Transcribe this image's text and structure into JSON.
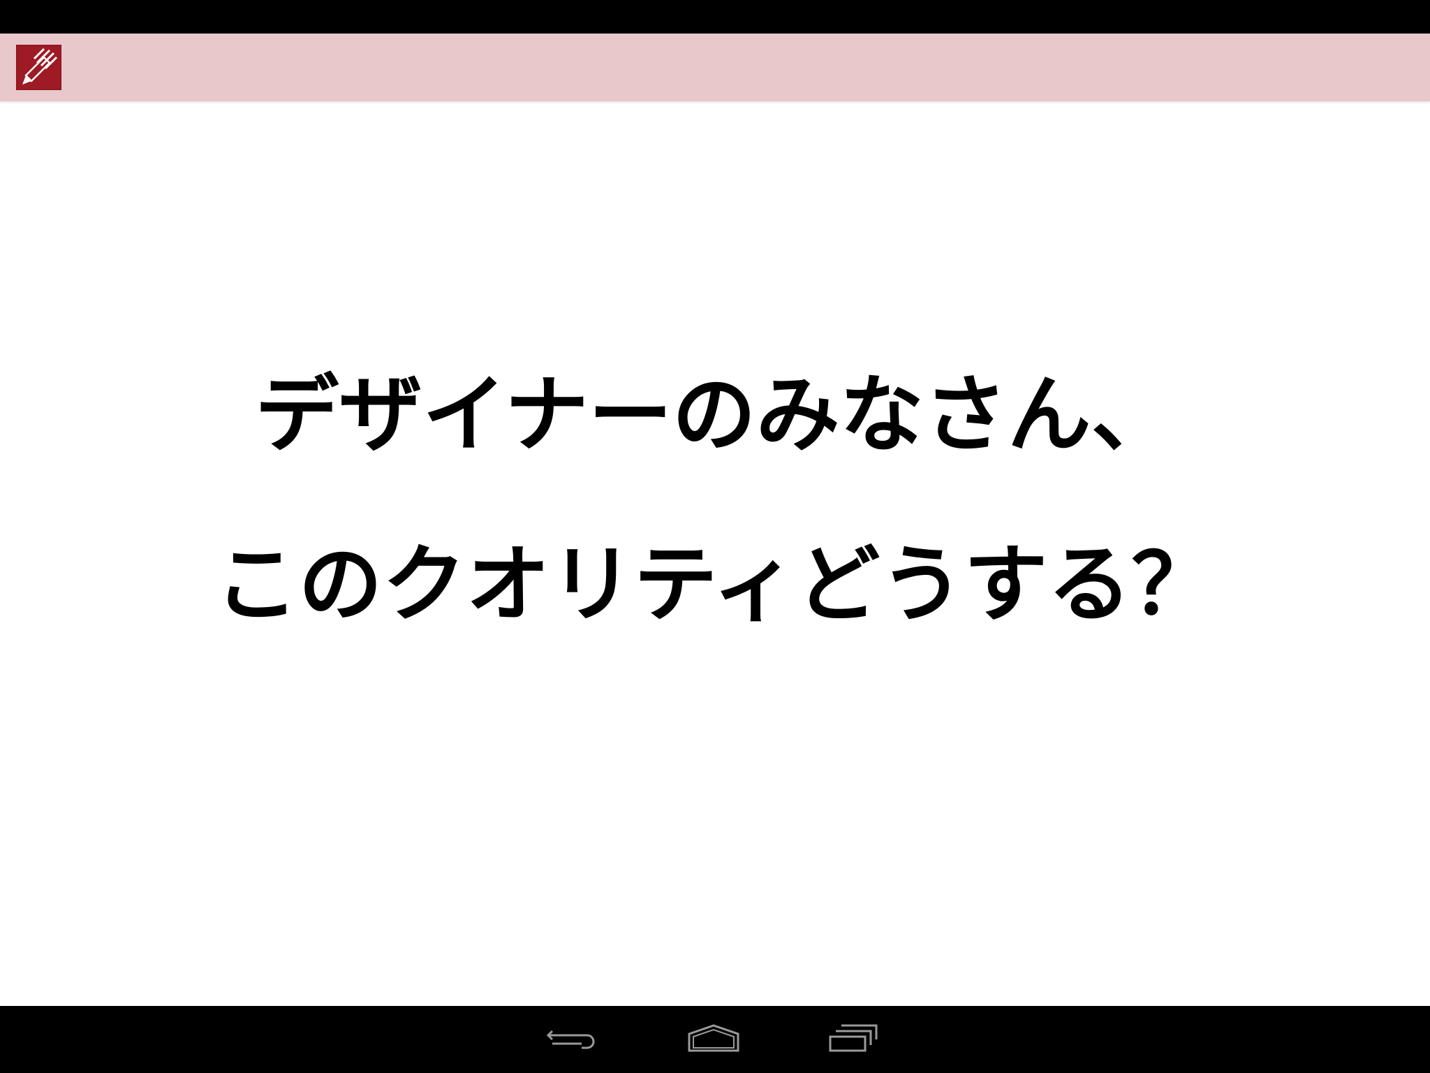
{
  "app_bar": {
    "background": "#e8c8cb",
    "icon": "pencil-notes-icon",
    "icon_color": "#9e1a24"
  },
  "slide": {
    "line1": "デザイナーのみなさん、",
    "line2": "このクオリティどうする？"
  },
  "nav_bar": {
    "back": "back-icon",
    "home": "home-icon",
    "recent": "recent-apps-icon"
  }
}
